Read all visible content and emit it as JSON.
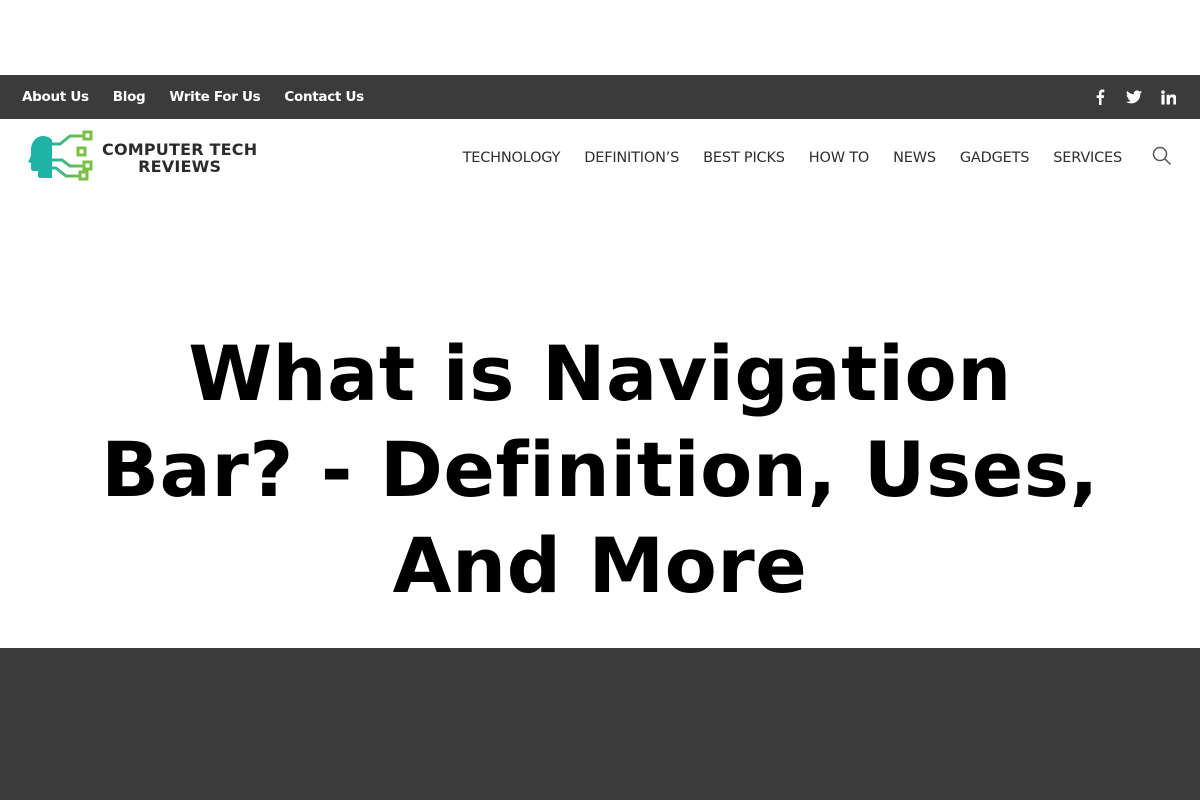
{
  "topbar": {
    "links": [
      {
        "label": "About Us"
      },
      {
        "label": "Blog"
      },
      {
        "label": "Write For Us"
      },
      {
        "label": "Contact Us"
      }
    ],
    "social": [
      {
        "icon": "facebook-icon",
        "label": "Facebook"
      },
      {
        "icon": "twitter-icon",
        "label": "Twitter"
      },
      {
        "icon": "linkedin-icon",
        "label": "LinkedIn"
      }
    ]
  },
  "header": {
    "logo": {
      "line1": "COMPUTER TECH",
      "line2": "REVIEWS",
      "icon": "head-circuit-logo-icon",
      "colors": {
        "teal": "#1fb3a6",
        "green": "#7ac143"
      }
    },
    "nav": [
      {
        "label": "TECHNOLOGY"
      },
      {
        "label": "DEFINITION’S"
      },
      {
        "label": "BEST PICKS"
      },
      {
        "label": "HOW TO"
      },
      {
        "label": "NEWS"
      },
      {
        "label": "GADGETS"
      },
      {
        "label": "SERVICES"
      }
    ],
    "search_icon": "search-icon"
  },
  "hero": {
    "title": "What is Navigation Bar? - Definition, Uses, And More"
  },
  "colors": {
    "topbar_bg": "#3b3b3b",
    "footer_band_bg": "#3b3b3b",
    "text_dark": "#2e2e2e"
  }
}
